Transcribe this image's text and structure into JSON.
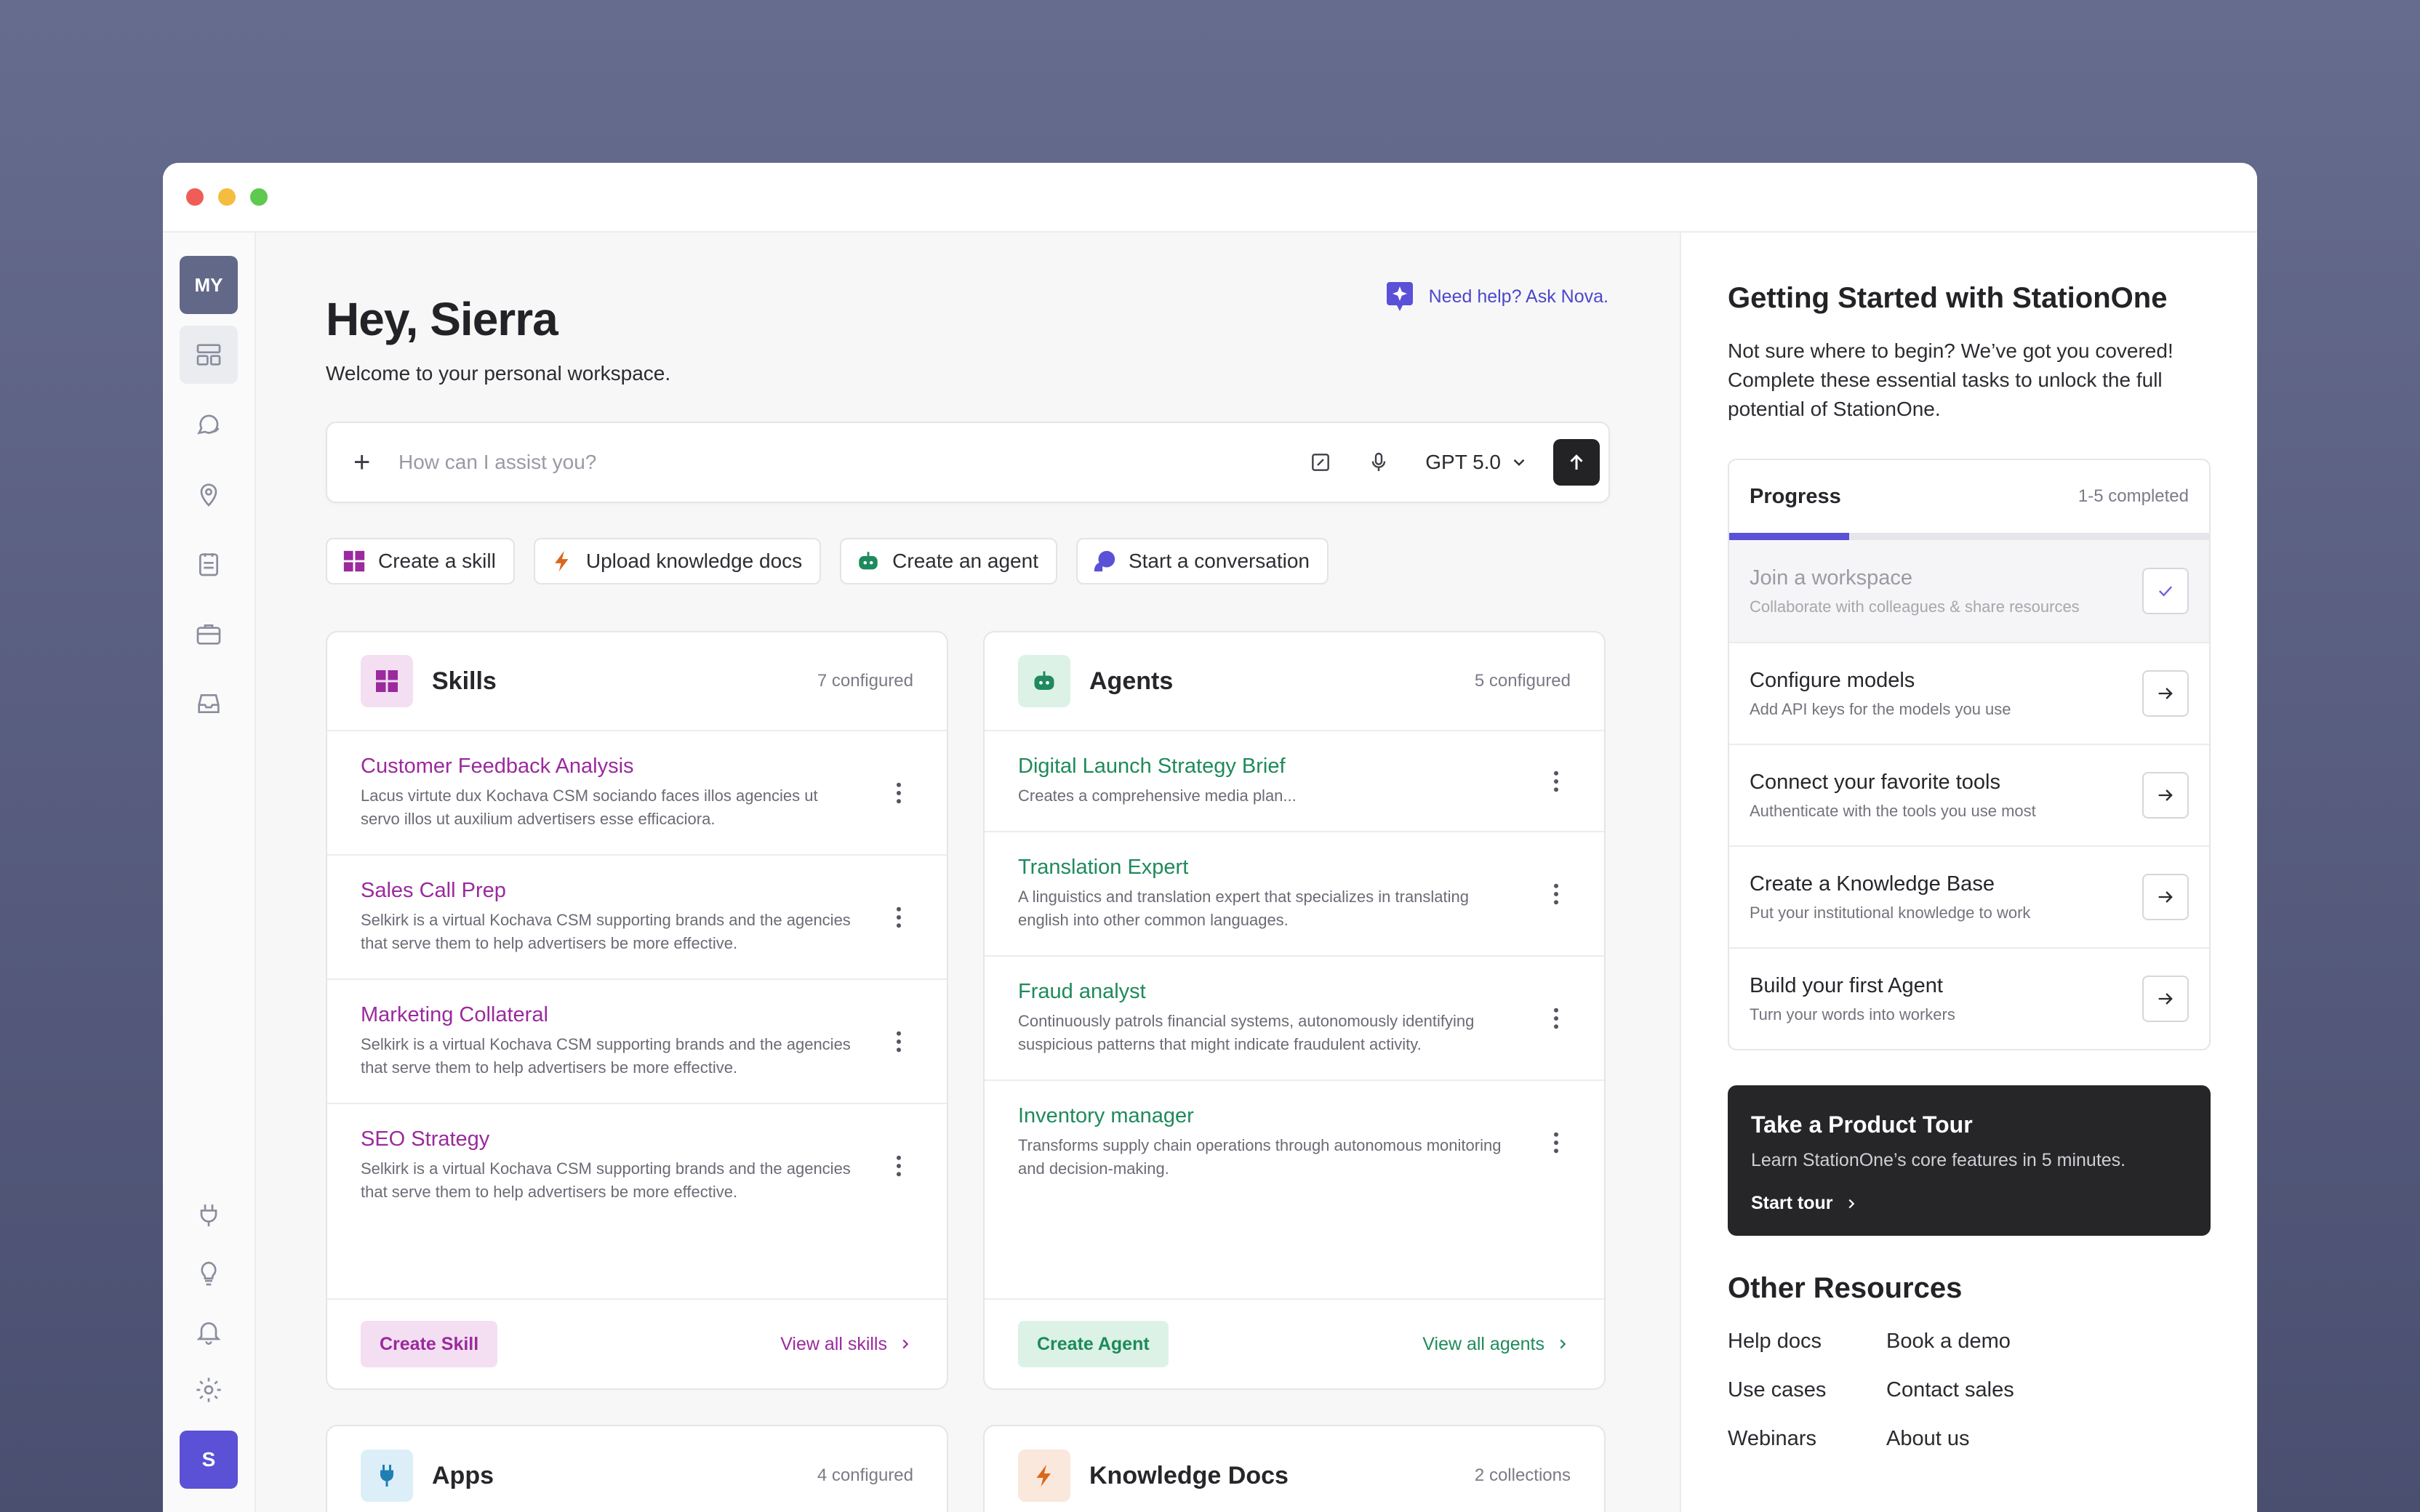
{
  "sidebar": {
    "workspace_initials": "MY",
    "user_initial": "S",
    "nav": [
      "layout-icon",
      "chat-icon",
      "location-icon",
      "clipboard-icon",
      "briefcase-icon",
      "inbox-icon"
    ],
    "bottom": [
      "plug-icon",
      "lightbulb-icon",
      "bell-icon",
      "gear-icon"
    ]
  },
  "main": {
    "title": "Hey, Sierra",
    "subtitle": "Welcome to your personal workspace.",
    "help_link": "Need help? Ask Nova.",
    "prompt": {
      "placeholder": "How can I assist you?",
      "model": "GPT 5.0"
    },
    "quick_actions": [
      {
        "label": "Create a skill",
        "icon": "skill-grid-icon",
        "color": "#9a2a9d"
      },
      {
        "label": "Upload knowledge docs",
        "icon": "bolt-icon",
        "color": "#d9671c"
      },
      {
        "label": "Create an agent",
        "icon": "robot-icon",
        "color": "#1f8a5c"
      },
      {
        "label": "Start a conversation",
        "icon": "chat-bubbles-icon",
        "color": "#5a51d6"
      }
    ],
    "skills": {
      "title": "Skills",
      "count": "7 configured",
      "items": [
        {
          "name": "Customer Feedback Analysis",
          "desc": "Lacus virtute dux Kochava CSM sociando faces illos agencies ut servo illos ut auxilium advertisers esse efficaciora."
        },
        {
          "name": "Sales Call Prep",
          "desc": "Selkirk is a virtual Kochava CSM supporting brands and the agencies that serve them to help advertisers be more effective."
        },
        {
          "name": "Marketing Collateral",
          "desc": "Selkirk is a virtual Kochava CSM supporting brands and the agencies that serve them to help advertisers be more effective."
        },
        {
          "name": "SEO Strategy",
          "desc": "Selkirk is a virtual Kochava CSM supporting brands and the agencies that serve them to help advertisers be more effective."
        }
      ],
      "create_label": "Create Skill",
      "view_all": "View all skills"
    },
    "agents": {
      "title": "Agents",
      "count": "5 configured",
      "items": [
        {
          "name": "Digital Launch Strategy Brief",
          "desc": "Creates a comprehensive media plan..."
        },
        {
          "name": "Translation Expert",
          "desc": "A linguistics and translation expert that specializes in translating english into other common languages."
        },
        {
          "name": "Fraud analyst",
          "desc": "Continuously patrols financial systems, autonomously identifying suspicious patterns that might indicate fraudulent activity."
        },
        {
          "name": "Inventory manager",
          "desc": "Transforms supply chain operations through autonomous monitoring and decision-making."
        }
      ],
      "create_label": "Create Agent",
      "view_all": "View all agents"
    },
    "apps": {
      "title": "Apps",
      "count": "4 configured"
    },
    "knowledge": {
      "title": "Knowledge Docs",
      "count": "2 collections"
    }
  },
  "right": {
    "title": "Getting Started with StationOne",
    "desc": "Not sure where to begin? We’ve got you covered! Complete these essential tasks to unlock the full potential of StationOne.",
    "progress": {
      "label": "Progress",
      "completed": "1-5 completed",
      "fraction": 0.25,
      "tasks": [
        {
          "name": "Join a workspace",
          "sub": "Collaborate with colleagues & share resources",
          "done": true
        },
        {
          "name": "Configure models",
          "sub": "Add API keys for the models you use",
          "done": false
        },
        {
          "name": "Connect your favorite tools",
          "sub": "Authenticate with the tools you use most",
          "done": false
        },
        {
          "name": "Create a Knowledge Base",
          "sub": "Put your institutional knowledge to work",
          "done": false
        },
        {
          "name": "Build your first Agent",
          "sub": "Turn your words into workers",
          "done": false
        }
      ]
    },
    "tour": {
      "title": "Take a Product Tour",
      "desc": "Learn StationOne’s core features in 5 minutes.",
      "link": "Start tour"
    },
    "resources": {
      "title": "Other Resources",
      "links": [
        "Help docs",
        "Book a demo",
        "Use cases",
        "Contact sales",
        "Webinars",
        "About us"
      ]
    }
  }
}
